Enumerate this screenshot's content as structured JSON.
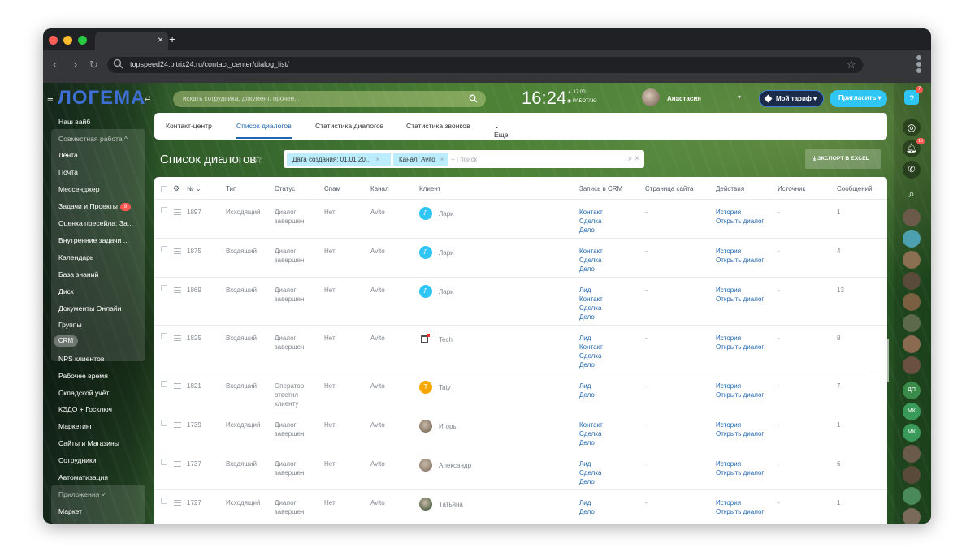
{
  "browser": {
    "url": "topspeed24.bitrix24.ru/contact_center/dialog_list/",
    "tab_close": "×",
    "tab_new": "+",
    "star": "☆"
  },
  "header": {
    "logo": "ЛОГЕМА",
    "search_placeholder": "искать сотрудника, документ, прочее...",
    "time": "16:24",
    "work_time": "17:00",
    "work_status": "РАБОТАЮ",
    "user_name": "Анастасия",
    "plan_label": "Мой тариф",
    "invite_label": "Пригласить",
    "help_badge": "7"
  },
  "sidebar": {
    "top_item": "Наш вайб",
    "group_label": "Совместная работа",
    "group_items": [
      "Лента",
      "Почта",
      "Мессенджер",
      "Задачи и Проекты",
      "Оценка пресейла: За...",
      "Внутренние задачи ...",
      "Календарь",
      "База знаний",
      "Диск",
      "Документы Онлайн",
      "Группы"
    ],
    "tasks_badge": "9",
    "crm_label": "CRM",
    "items": [
      "NPS клиентов",
      "Рабочее время",
      "Складской учёт",
      "КЭДО + Госключ",
      "Маркетинг",
      "Сайты и Магазины",
      "Сотрудники",
      "Автоматизация"
    ],
    "apps_label": "Приложения",
    "market_label": "Маркет"
  },
  "tabs": [
    "Контакт-центр",
    "Список диалогов",
    "Статистика диалогов",
    "Статистика звонков",
    "Еще"
  ],
  "page": {
    "title": "Список диалогов",
    "filter_chip_1": "Дата создания: 01.01.20...",
    "filter_chip_2": "Канал: Avito",
    "filter_plus": "+",
    "filter_input": "поиск",
    "export_label": "ЭКСПОРТ В EXCEL"
  },
  "table": {
    "columns": [
      "№",
      "Тип",
      "Статус",
      "Спам",
      "Канал",
      "Клиент",
      "Запись в CRM",
      "Страница сайта",
      "Действия",
      "Источник",
      "Сообщений"
    ],
    "rows": [
      {
        "id": "1897",
        "type": "Исходящий",
        "status": [
          "Диалог",
          "завершен"
        ],
        "spam": "Нет",
        "channel": "Avito",
        "client": "Лари",
        "initial": "Л",
        "avatar_color": "#2fc6f6",
        "crm": [
          "Контакт",
          "Сделка",
          "Дело"
        ],
        "page": "-",
        "actions": [
          "История",
          "Открыть диалог"
        ],
        "source": "-",
        "messages": "1"
      },
      {
        "id": "1875",
        "type": "Входящий",
        "status": [
          "Диалог",
          "завершен"
        ],
        "spam": "Нет",
        "channel": "Avito",
        "client": "Лари",
        "initial": "Л",
        "avatar_color": "#2fc6f6",
        "crm": [
          "Контакт",
          "Сделка",
          "Дело"
        ],
        "page": "-",
        "actions": [
          "История",
          "Открыть диалог"
        ],
        "source": "-",
        "messages": "4"
      },
      {
        "id": "1869",
        "type": "Входящий",
        "status": [
          "Диалог",
          "завершен"
        ],
        "spam": "Нет",
        "channel": "Avito",
        "client": "Лари",
        "initial": "Л",
        "avatar_color": "#2fc6f6",
        "crm": [
          "Лид",
          "Контакт",
          "Сделка",
          "Дело"
        ],
        "page": "-",
        "actions": [
          "История",
          "Открыть диалог"
        ],
        "source": "-",
        "messages": "13"
      },
      {
        "id": "1825",
        "type": "Входящий",
        "status": [
          "Диалог",
          "завершен"
        ],
        "spam": "Нет",
        "channel": "Avito",
        "client": "Tech",
        "initial": "",
        "avatar_color": "#ffffff",
        "crm": [
          "Лид",
          "Контакт",
          "Сделка",
          "Дело"
        ],
        "page": "-",
        "actions": [
          "История",
          "Открыть диалог"
        ],
        "source": "-",
        "messages": "8"
      },
      {
        "id": "1821",
        "type": "Входящий",
        "status": [
          "Оператор",
          "ответил",
          "клиенту"
        ],
        "spam": "Нет",
        "channel": "Avito",
        "client": "Taty",
        "initial": "T",
        "avatar_color": "#f7a700",
        "crm": [
          "Лид",
          "Дело"
        ],
        "page": "-",
        "actions": [
          "История",
          "Открыть диалог"
        ],
        "source": "-",
        "messages": "7"
      },
      {
        "id": "1739",
        "type": "Исходящий",
        "status": [
          "Диалог",
          "завершен"
        ],
        "spam": "Нет",
        "channel": "Avito",
        "client": "Игорь",
        "initial": "",
        "avatar_color": "#6b5a48",
        "crm": [
          "Контакт",
          "Сделка",
          "Дело"
        ],
        "page": "-",
        "actions": [
          "История",
          "Открыть диалог"
        ],
        "source": "-",
        "messages": "1"
      },
      {
        "id": "1737",
        "type": "Входящий",
        "status": [
          "Диалог",
          "завершен"
        ],
        "spam": "Нет",
        "channel": "Avito",
        "client": "Александр",
        "initial": "",
        "avatar_color": "#7a6a5a",
        "crm": [
          "Лид",
          "Сделка",
          "Дело"
        ],
        "page": "-",
        "actions": [
          "История",
          "Открыть диалог"
        ],
        "source": "-",
        "messages": "6"
      },
      {
        "id": "1727",
        "type": "Исходящий",
        "status": [
          "Диалог",
          "завершен"
        ],
        "spam": "Нет",
        "channel": "Avito",
        "client": "Татьяна",
        "initial": "",
        "avatar_color": "#2d4a2a",
        "crm": [
          "Лид",
          "Дело"
        ],
        "page": "-",
        "actions": [
          "История",
          "Открыть диалог"
        ],
        "source": "-",
        "messages": "1"
      }
    ]
  },
  "rightbar": {
    "labels": [
      "ДП",
      "МК",
      "МК"
    ],
    "notif_badge": "13"
  },
  "colors": {
    "accent": "#2fc6f6",
    "link": "#2067b0",
    "plan_border": "#3f7fd9",
    "badge": "#ff5752"
  }
}
